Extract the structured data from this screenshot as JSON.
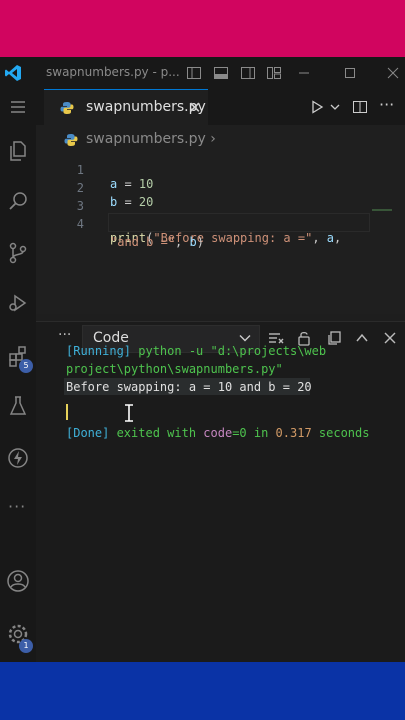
{
  "window": {
    "title": "swapnumbers.py - p..."
  },
  "tab": {
    "label": "swapnumbers.py",
    "close_glyph": "✕"
  },
  "breadcrumb": {
    "file": "swapnumbers.py",
    "sep": "›"
  },
  "code": {
    "line_numbers": [
      "1",
      "2",
      "3",
      "4"
    ],
    "l1": {
      "var": "a",
      "op": " = ",
      "num": "10"
    },
    "l2": {
      "var": "b",
      "op": " = ",
      "num": "20"
    },
    "l4": {
      "fn": "print",
      "p1": "(",
      "str1": "\"Before swapping: a =\"",
      "c1": ", ",
      "var1": "a",
      "c2": ",",
      "str2": "\"and b =\"",
      "c3": ", ",
      "var2": "b",
      "p2": ")"
    }
  },
  "panel": {
    "dots": "···",
    "dropdown_value": "Code",
    "running_tag": "[Running]",
    "cmd_part1": " python -u \"d:\\projects\\web",
    "cmd_part2": "project\\python\\swapnumbers.py\"",
    "output_line": "Before swapping: a = 10 and b = 20",
    "done_tag": "[Done]",
    "exited_text": " exited with ",
    "code_kw": "code",
    "code_eq": "=0",
    "in_text": " in ",
    "secs_val": "0.317",
    "secs_text": " seconds"
  },
  "badges": {
    "extensions": "5",
    "settings": "1"
  },
  "colors": {
    "top_band": "#d1055f",
    "bottom_band": "#0a33a6",
    "accent": "#0078d4"
  }
}
